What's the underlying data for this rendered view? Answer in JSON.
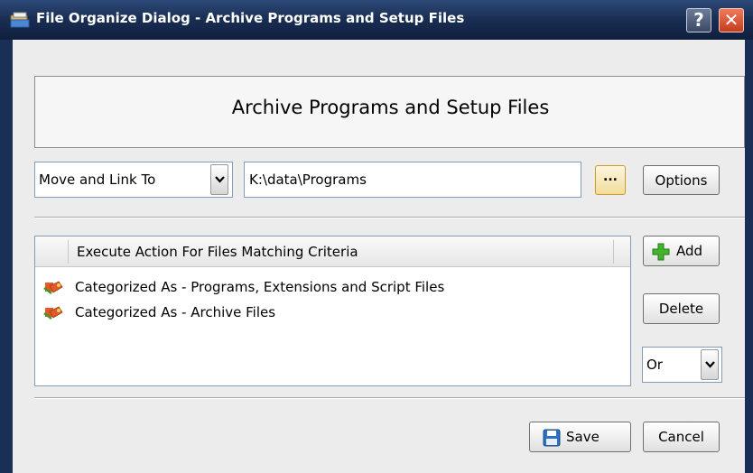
{
  "window": {
    "title": "File Organize Dialog - Archive Programs and Setup Files",
    "help_glyph": "?",
    "close_glyph": "✕"
  },
  "header": {
    "title": "Archive Programs and Setup Files"
  },
  "action": {
    "selected": "Move and Link To",
    "path": "K:\\data\\Programs",
    "browse_label": "...",
    "options_label": "Options"
  },
  "criteria": {
    "column_header": "Execute Action For Files Matching Criteria",
    "rows": [
      {
        "label": "Categorized As - Programs, Extensions and Script Files",
        "icon": "category-icon"
      },
      {
        "label": "Categorized As - Archive Files",
        "icon": "category-icon"
      }
    ],
    "add_label": "Add",
    "delete_label": "Delete",
    "logic_selected": "Or"
  },
  "footer": {
    "save_label": "Save",
    "cancel_label": "Cancel"
  },
  "colors": {
    "titlebar": "#1a2f55",
    "client_bg": "#ececec",
    "close_button": "#d84a27",
    "browse_button": "#f1dd9a",
    "add_icon": "#3fa62a",
    "save_icon": "#2d72c2"
  }
}
